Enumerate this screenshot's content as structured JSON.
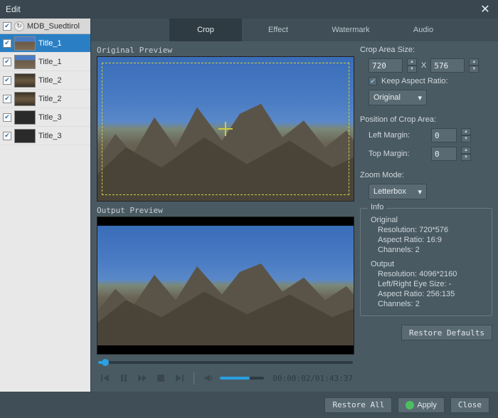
{
  "window_title": "Edit",
  "sidebar": {
    "source_name": "MDB_Suedtirol",
    "items": [
      {
        "label": "Title_1",
        "checked": true,
        "thumb": "mtn",
        "active": true
      },
      {
        "label": "Title_1",
        "checked": true,
        "thumb": "mtn",
        "active": false
      },
      {
        "label": "Title_2",
        "checked": true,
        "thumb": "brown",
        "active": false
      },
      {
        "label": "Title_2",
        "checked": true,
        "thumb": "brown",
        "active": false
      },
      {
        "label": "Title_3",
        "checked": true,
        "thumb": "dark",
        "active": false
      },
      {
        "label": "Title_3",
        "checked": true,
        "thumb": "dark",
        "active": false
      }
    ]
  },
  "tabs": {
    "crop": "Crop",
    "effect": "Effect",
    "watermark": "Watermark",
    "audio": "Audio"
  },
  "preview": {
    "original_label": "Original Preview",
    "output_label": "Output Preview"
  },
  "playback": {
    "time": "00:00:02/01:43:37"
  },
  "crop": {
    "size_title": "Crop Area Size:",
    "width": "720",
    "x_label": "X",
    "height": "576",
    "keep_ar_label": "Keep Aspect Ratio:",
    "ar_selected": "Original",
    "pos_title": "Position of Crop Area:",
    "left_label": "Left Margin:",
    "left_val": "0",
    "top_label": "Top Margin:",
    "top_val": "0",
    "zoom_title": "Zoom Mode:",
    "zoom_selected": "Letterbox"
  },
  "info": {
    "legend": "Info",
    "original_header": "Original",
    "orig_res_label": "Resolution:",
    "orig_res": "720*576",
    "orig_ar_label": "Aspect Ratio:",
    "orig_ar": "16:9",
    "orig_ch_label": "Channels:",
    "orig_ch": "2",
    "output_header": "Output",
    "out_res_label": "Resolution:",
    "out_res": "4096*2160",
    "out_eye_label": "Left/Right Eye Size:",
    "out_eye": "-",
    "out_ar_label": "Aspect Ratio:",
    "out_ar": "256:135",
    "out_ch_label": "Channels:",
    "out_ch": "2"
  },
  "buttons": {
    "restore_defaults": "Restore Defaults",
    "restore_all": "Restore All",
    "apply": "Apply",
    "close": "Close"
  }
}
